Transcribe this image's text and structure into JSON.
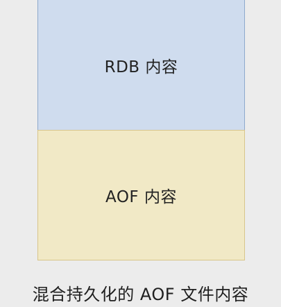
{
  "diagram": {
    "blocks": [
      {
        "label": "RDB 内容",
        "fill": "#cfdcee",
        "border": "#8ea9cc"
      },
      {
        "label": "AOF 内容",
        "fill": "#f1e9c6",
        "border": "#d8c58a"
      }
    ],
    "caption": "混合持久化的 AOF 文件内容"
  },
  "colors": {
    "background": "#ececec",
    "text": "#222222"
  }
}
